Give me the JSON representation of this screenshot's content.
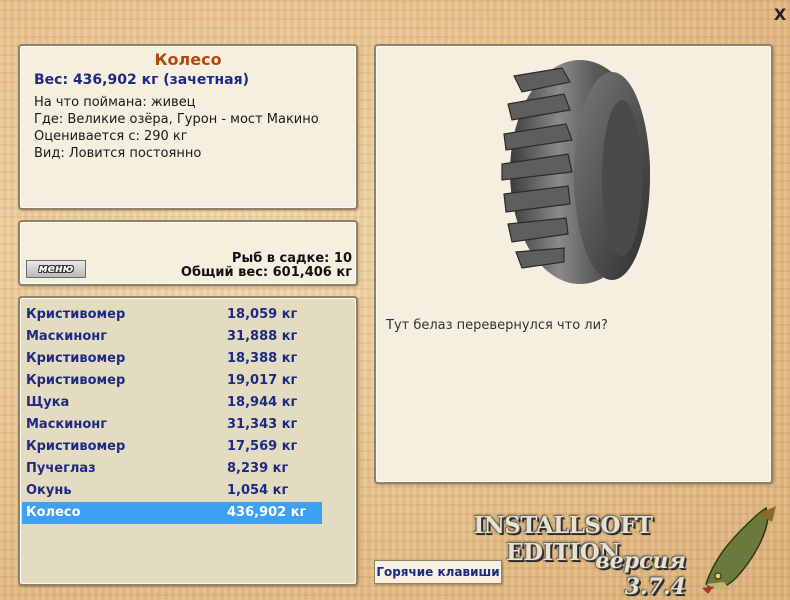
{
  "window": {
    "close_label": "X"
  },
  "catch": {
    "title": "Колесо",
    "weight": "Вес: 436,902 кг (зачетная)",
    "caught_on": "На что поймана: живец",
    "location": "Где: Великие озёра, Гурон - мост Макино",
    "valued_from": "Оценивается с: 290 кг",
    "type": "Вид: Ловится постоянно"
  },
  "keepnet": {
    "menu_label": "меню",
    "fish_count": "Рыб в садке: 10",
    "total_weight": "Общий вес: 601,406 кг"
  },
  "fish_list": [
    {
      "name": "Кристивомер",
      "weight": "18,059 кг"
    },
    {
      "name": "Маскинонг",
      "weight": "31,888 кг"
    },
    {
      "name": "Кристивомер",
      "weight": "18,388 кг"
    },
    {
      "name": "Кристивомер",
      "weight": "19,017 кг"
    },
    {
      "name": "Щука",
      "weight": "18,944 кг"
    },
    {
      "name": "Маскинонг",
      "weight": "31,343 кг"
    },
    {
      "name": "Кристивомер",
      "weight": "17,569 кг"
    },
    {
      "name": "Пучеглаз",
      "weight": "8,239 кг"
    },
    {
      "name": "Окунь",
      "weight": "1,054 кг"
    },
    {
      "name": "Колесо",
      "weight": "436,902 кг",
      "selected": true
    }
  ],
  "picture": {
    "icon": "tire-image",
    "caption": "Тут белаз перевернулся что ли?"
  },
  "footer": {
    "hotkeys_label": "Горячие клавиши",
    "brand": "INSTALLSOFT EDITION",
    "version": "версия 3.7.4",
    "logo_icon": "pike-icon"
  },
  "colors": {
    "title": "#b24a0c",
    "accent_text": "#1d2a85",
    "selection": "#3ea0f0"
  }
}
